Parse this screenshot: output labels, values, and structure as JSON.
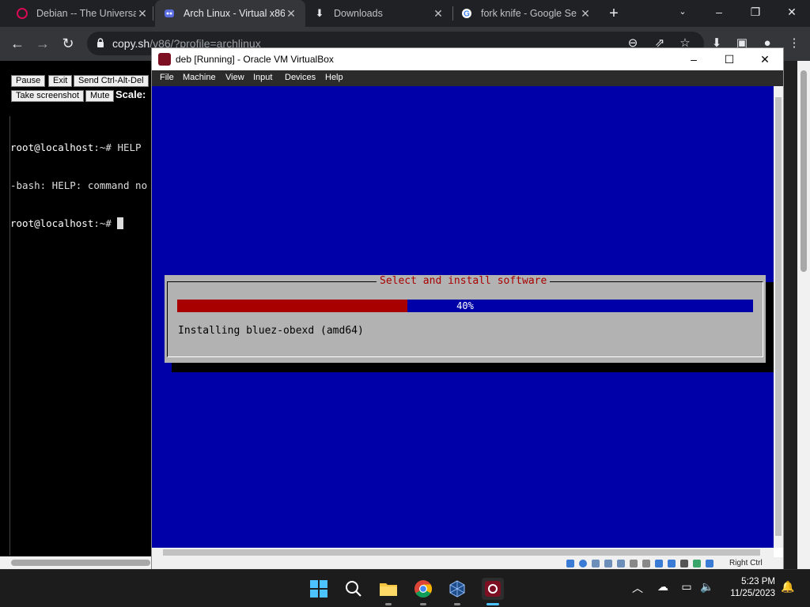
{
  "browser": {
    "tabs": [
      {
        "title": "Debian -- The Universal",
        "icon": "debian-swirl-icon",
        "active": false
      },
      {
        "title": "Arch Linux - Virtual x86",
        "icon": "v86-icon",
        "active": true
      },
      {
        "title": "Downloads",
        "icon": "download-icon",
        "active": false
      },
      {
        "title": "fork knife - Google Se",
        "icon": "google-icon",
        "active": false
      }
    ],
    "url_host": "copy.sh",
    "url_path": "/v86/?profile=archlinux"
  },
  "page": {
    "buttons": [
      "Pause",
      "Exit",
      "Send Ctrl-Alt-Del",
      "Take screenshot",
      "Mute"
    ],
    "scale_label": "Scale:",
    "terminal_lines": [
      {
        "prompt": "root@localhost",
        "rest": ":~# HELP"
      },
      {
        "prompt": "",
        "rest": "-bash: HELP: command no"
      },
      {
        "prompt": "root@localhost",
        "rest": ":~# "
      }
    ]
  },
  "vbox": {
    "title": "deb [Running] - Oracle VM VirtualBox",
    "menu": [
      "File",
      "Machine",
      "View",
      "Input",
      "Devices",
      "Help"
    ],
    "host_key": "Right Ctrl"
  },
  "installer": {
    "dialog_title": "Select and install software",
    "progress_percent": 40,
    "progress_label": "40%",
    "status_text": "Installing bluez-obexd (amd64)",
    "colors": {
      "background": "#0000a8",
      "dialog": "#b2b2b2",
      "bar_fill": "#a80000",
      "title": "#a80000"
    }
  },
  "taskbar": {
    "apps": [
      "start-icon",
      "search-icon",
      "file-explorer-icon",
      "chrome-icon",
      "virtualbox-icon",
      "debian-icon"
    ],
    "time": "5:23 PM",
    "date": "11/25/2023"
  }
}
